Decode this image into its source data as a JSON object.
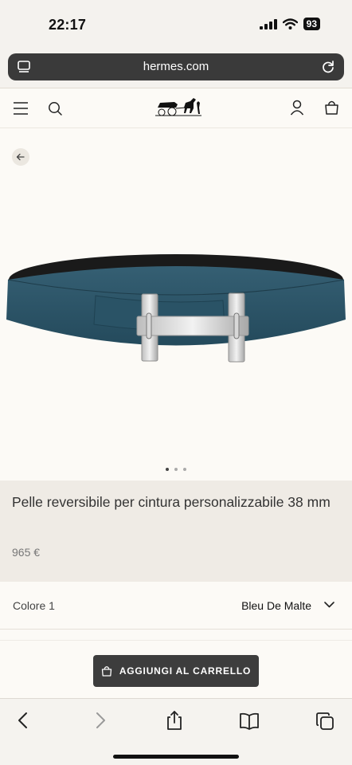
{
  "status_bar": {
    "time": "22:17",
    "battery": "93",
    "icons": [
      "cellular-signal-icon",
      "wifi-icon",
      "battery-icon"
    ]
  },
  "browser": {
    "url": "hermes.com",
    "left_icon": "page-menu-icon",
    "right_icon": "reload-icon"
  },
  "header": {
    "icons": [
      "menu-icon",
      "search-icon",
      "hermes-logo",
      "account-icon",
      "bag-icon"
    ]
  },
  "gallery": {
    "back_icon": "arrow-left-icon",
    "image": "reversible-belt-with-h-buckle",
    "dot_count": 3,
    "active_dot": 0
  },
  "product": {
    "title": "Pelle reversibile per cintura personalizzabile 38 mm",
    "price": "965 €"
  },
  "color": {
    "label": "Colore 1",
    "value": "Bleu De Malte"
  },
  "cta": {
    "label": "AGGIUNGI AL CARRELLO"
  },
  "toolbar": {
    "icons": [
      "back-icon",
      "forward-icon",
      "share-icon",
      "bookmarks-icon",
      "tabs-icon"
    ]
  },
  "colors": {
    "belt_blue": "#2f5a6e",
    "button_dark": "#3d3d3d",
    "panel_beige": "#efebe5"
  }
}
